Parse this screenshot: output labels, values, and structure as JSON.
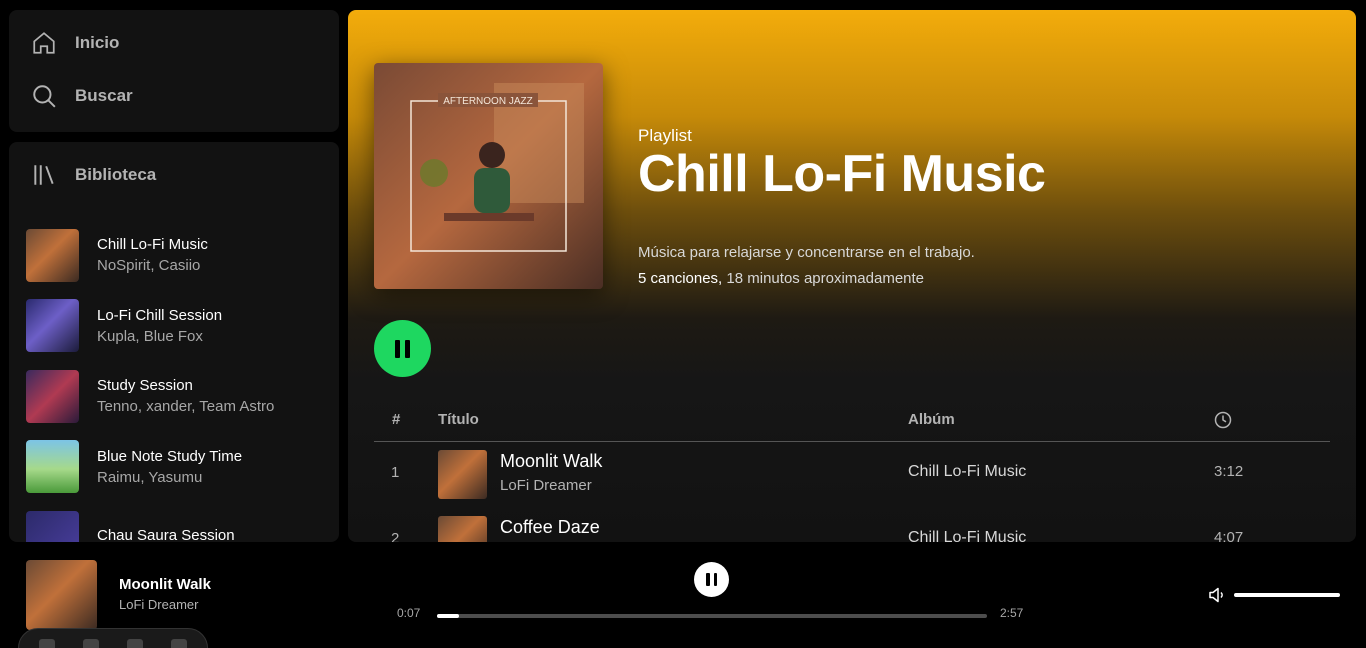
{
  "nav": {
    "home_label": "Inicio",
    "search_label": "Buscar",
    "home_icon": "home-icon",
    "search_icon": "search-icon"
  },
  "library": {
    "header": "Biblioteca",
    "icon": "library-icon",
    "items": [
      {
        "title": "Chill Lo-Fi Music",
        "subtitle": "NoSpirit, Casiio"
      },
      {
        "title": "Lo-Fi Chill Session",
        "subtitle": "Kupla, Blue Fox"
      },
      {
        "title": "Study Session",
        "subtitle": "Tenno, xander, Team Astro"
      },
      {
        "title": "Blue Note Study Time",
        "subtitle": "Raimu, Yasumu"
      },
      {
        "title": "Chau Saura Session",
        "subtitle": ""
      }
    ]
  },
  "playlist": {
    "type_label": "Playlist",
    "title": "Chill Lo-Fi Music",
    "cover_text": "AFTERNOON JAZZ",
    "description": "Música para relajarse y concentrarse en el trabajo.",
    "song_count": "5 canciones,",
    "duration": "18 minutos aproximadamente"
  },
  "table": {
    "col_num": "#",
    "col_title": "Título",
    "col_album": "Albúm",
    "col_duration_icon": "clock-icon",
    "rows": [
      {
        "num": "1",
        "title": "Moonlit Walk",
        "artist": "LoFi Dreamer",
        "album": "Chill Lo-Fi Music",
        "duration": "3:12"
      },
      {
        "num": "2",
        "title": "Coffee Daze",
        "artist": "",
        "album": "Chill Lo-Fi Music",
        "duration": "4:07"
      }
    ]
  },
  "player": {
    "track_title": "Moonlit Walk",
    "track_artist": "LoFi Dreamer",
    "current_time": "0:07",
    "total_time": "2:57",
    "progress_fraction": 0.04,
    "volume_fraction": 1.0
  },
  "colors": {
    "accent_green": "#1ed760",
    "header_gradient_top": "#f3ac0b",
    "panel_bg": "#121212"
  }
}
